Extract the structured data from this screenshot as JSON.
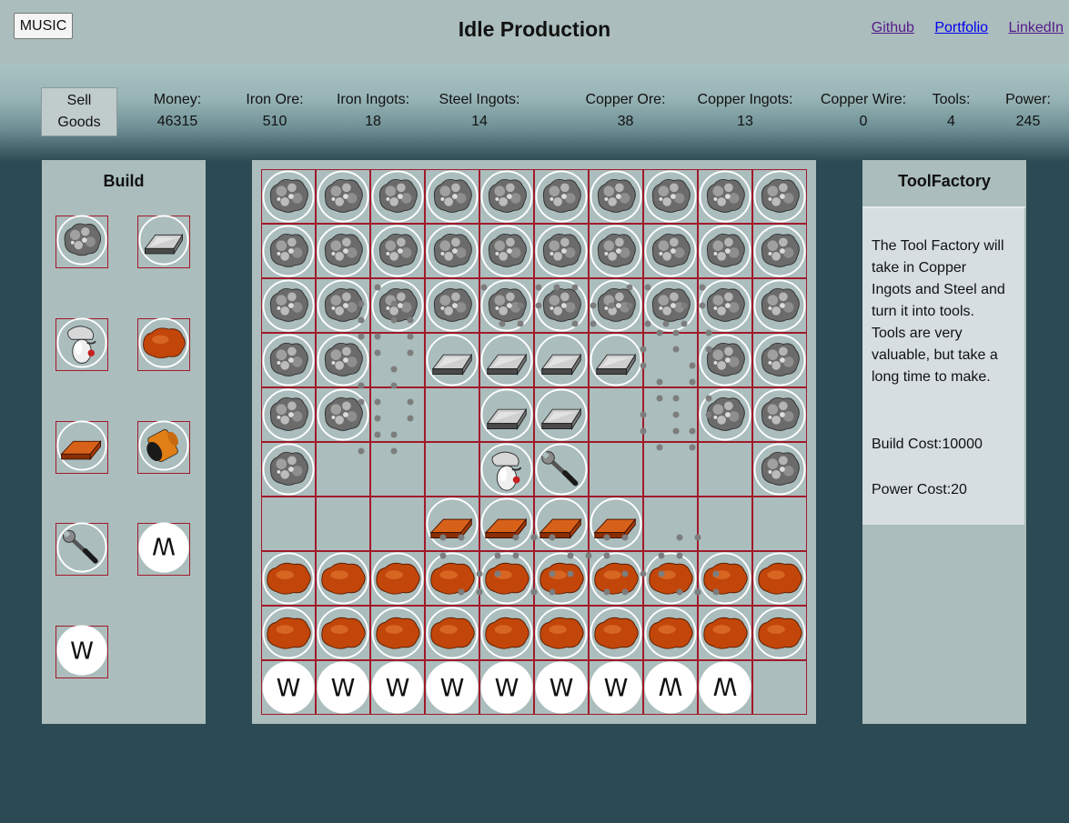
{
  "header": {
    "music_label": "MUSIC",
    "title": "Idle Production",
    "links": [
      "Github",
      "Portfolio",
      "LinkedIn"
    ]
  },
  "stats": {
    "sell_label_line1": "Sell",
    "sell_label_line2": "Goods",
    "items": [
      {
        "label": "Money:",
        "value": "46315"
      },
      {
        "label": "Iron Ore:",
        "value": "510"
      },
      {
        "label": "Iron Ingots:",
        "value": "18"
      },
      {
        "label": "Steel Ingots:",
        "value": "14"
      },
      {
        "label": "Copper Ore:",
        "value": "38"
      },
      {
        "label": "Copper Ingots:",
        "value": "13"
      },
      {
        "label": "Copper Wire:",
        "value": "0"
      },
      {
        "label": "Tools:",
        "value": "4"
      },
      {
        "label": "Power:",
        "value": "245"
      }
    ]
  },
  "build": {
    "title": "Build",
    "items": [
      "iron-ore-icon",
      "iron-ingot-icon",
      "steel-smelter-icon",
      "copper-ore-icon",
      "copper-ingot-icon",
      "copper-wire-spool-icon",
      "wrench-icon",
      "power-m-icon",
      "power-w-icon"
    ]
  },
  "board": {
    "legend": {
      ".": "empty",
      "I": "iron-ore-icon",
      "B": "iron-ingot-icon",
      "S": "steel-smelter-icon",
      "T": "wrench-icon",
      "C": "copper-ore-icon",
      "P": "copper-ingot-icon",
      "W": "power-w-icon",
      "M": "power-m-icon"
    },
    "rows": [
      "IIIIIIIIII",
      "IIIIIIIIII",
      "IIIIIIIIII",
      "II.BBBB.II",
      "II..BB..II",
      "I...ST...I",
      "...PPPP...",
      "CCCCCCCCCC",
      "CCCCCCCCCC",
      "WWWWWWWMM."
    ],
    "w_label": "W",
    "m_label": "W"
  },
  "info": {
    "title": "ToolFactory",
    "description": "The Tool Factory will take in Copper Ingots and Steel and turn it into tools. Tools are very valuable, but take a long time to make.",
    "build_cost": "Build Cost:10000",
    "power_cost": "Power Cost:20"
  },
  "colors": {
    "page_bg": "#2c4a53",
    "panel_bg": "#abbdbd",
    "info_bg": "#d6dee2",
    "grid_line": "#a11a2a",
    "iron": "#6b6b6b",
    "copper": "#c2460a",
    "item_dot": "#7d7d7d"
  }
}
